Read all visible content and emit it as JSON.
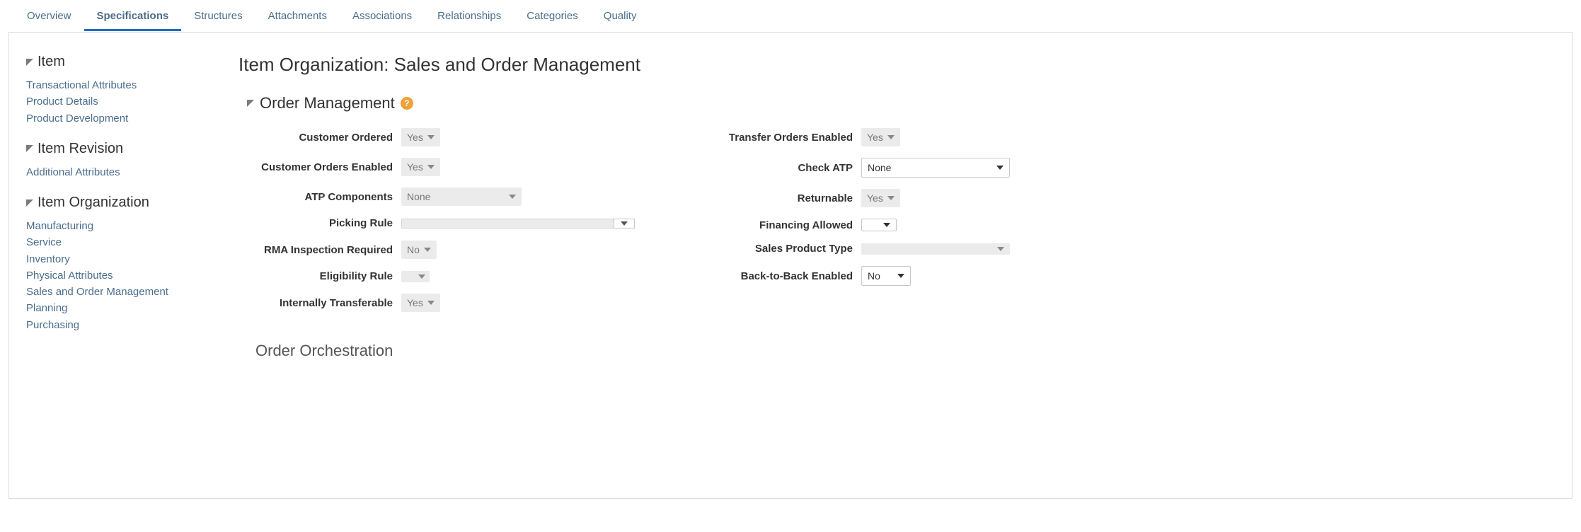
{
  "tabs": [
    {
      "label": "Overview",
      "active": false
    },
    {
      "label": "Specifications",
      "active": true
    },
    {
      "label": "Structures",
      "active": false
    },
    {
      "label": "Attachments",
      "active": false
    },
    {
      "label": "Associations",
      "active": false
    },
    {
      "label": "Relationships",
      "active": false
    },
    {
      "label": "Categories",
      "active": false
    },
    {
      "label": "Quality",
      "active": false
    }
  ],
  "sidebar": {
    "groups": [
      {
        "title": "Item",
        "links": [
          "Transactional Attributes",
          "Product Details",
          "Product Development"
        ]
      },
      {
        "title": "Item Revision",
        "links": [
          "Additional Attributes"
        ]
      },
      {
        "title": "Item Organization",
        "links": [
          "Manufacturing",
          "Service",
          "Inventory",
          "Physical Attributes",
          "Sales and Order Management",
          "Planning",
          "Purchasing"
        ]
      }
    ]
  },
  "main": {
    "title": "Item Organization: Sales and Order Management",
    "section": "Order Management",
    "help": "?",
    "order_orchestration": "Order Orchestration",
    "left": [
      {
        "label": "Customer Ordered",
        "value": "Yes",
        "kind": "sel-disabled"
      },
      {
        "label": "Customer Orders Enabled",
        "value": "Yes",
        "kind": "sel-disabled"
      },
      {
        "label": "ATP Components",
        "value": "None",
        "kind": "sel-disabled-wide"
      },
      {
        "label": "Picking Rule",
        "value": "",
        "kind": "combo"
      },
      {
        "label": "RMA Inspection Required",
        "value": "No",
        "kind": "sel-disabled"
      },
      {
        "label": "Eligibility Rule",
        "value": "",
        "kind": "sel-disabled-tiny"
      },
      {
        "label": "Internally Transferable",
        "value": "Yes",
        "kind": "sel-disabled"
      }
    ],
    "right": [
      {
        "label": "Transfer Orders Enabled",
        "value": "Yes",
        "kind": "sel-disabled"
      },
      {
        "label": "Check ATP",
        "value": "None",
        "kind": "sel-white-wide"
      },
      {
        "label": "Returnable",
        "value": "Yes",
        "kind": "sel-disabled"
      },
      {
        "label": "Financing Allowed",
        "value": "",
        "kind": "sel-white-tiny"
      },
      {
        "label": "Sales Product Type",
        "value": "",
        "kind": "sel-disabled-210"
      },
      {
        "label": "Back-to-Back Enabled",
        "value": "No",
        "kind": "sel-white-small"
      }
    ]
  }
}
